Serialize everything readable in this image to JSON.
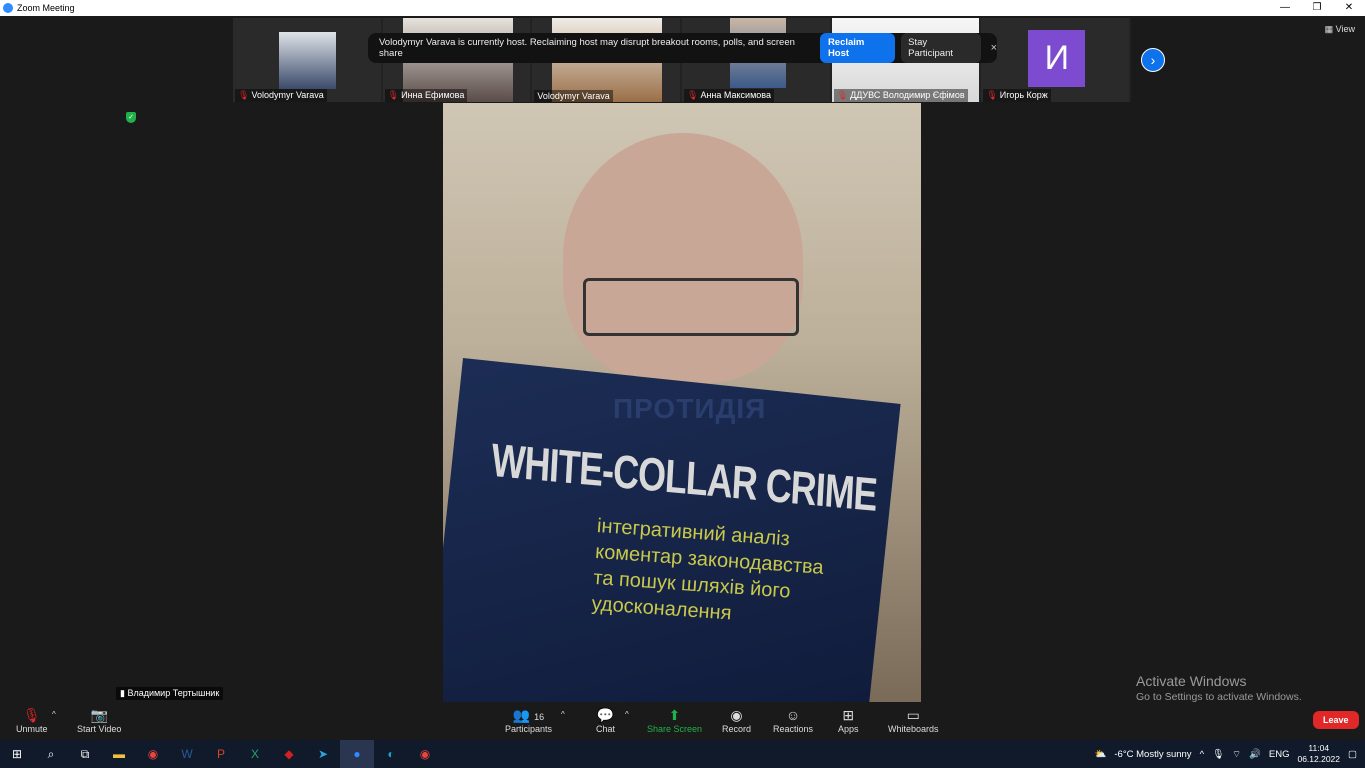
{
  "window": {
    "title": "Zoom Meeting",
    "controls": [
      "—",
      "❐",
      "✕"
    ]
  },
  "view_label": "View",
  "gallery": [
    {
      "name": "Volodymyr Varava",
      "muted": true
    },
    {
      "name": "Инна Ефимова",
      "muted": true
    },
    {
      "name": "Volodymyr Varava",
      "muted": false
    },
    {
      "name": "Анна Максимова",
      "muted": true
    },
    {
      "name": "ДДУВС Володимир Єфімов",
      "muted": true
    },
    {
      "name": "Игорь Корж",
      "muted": true,
      "avatar_letter": "И"
    }
  ],
  "notice": {
    "message": "Volodymyr Varava is currently host. Reclaiming host may disrupt breakout rooms, polls, and screen share",
    "reclaim": "Reclaim Host",
    "stay": "Stay Participant",
    "close": "×"
  },
  "main_video": {
    "speaker": "Владимир Тертышник",
    "book_title_ua": "ПРОТИДІЯ",
    "book_title_en": "WHITE-COLLAR CRIME",
    "book_subtitle": "інтегративний аналіз\nкоментар законодавства\nта пошук шляхів його\nудосконалення"
  },
  "activate_windows": {
    "line1": "Activate Windows",
    "line2": "Go to Settings to activate Windows."
  },
  "toolbar": {
    "unmute": "Unmute",
    "start_video": "Start Video",
    "participants": "Participants",
    "participants_count": "16",
    "chat": "Chat",
    "share_screen": "Share Screen",
    "record": "Record",
    "reactions": "Reactions",
    "apps": "Apps",
    "whiteboards": "Whiteboards",
    "leave": "Leave"
  },
  "taskbar": {
    "weather": "-6°C  Mostly sunny",
    "language": "ENG",
    "time": "11:04",
    "date": "06.12.2022"
  },
  "colors": {
    "accent": "#0e72ed",
    "leave": "#e02828",
    "share": "#21b14b",
    "avatar": "#7d4bcf"
  }
}
